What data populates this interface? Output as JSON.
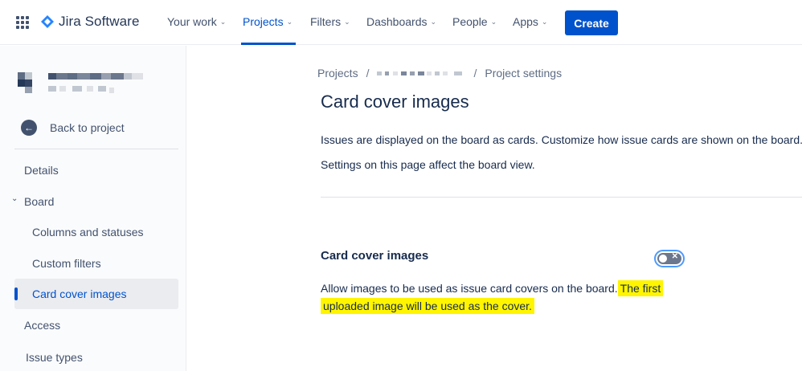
{
  "app": {
    "brand": "Jira Software",
    "brand_color": "#0052cc"
  },
  "topnav": {
    "items": [
      {
        "label": "Your work"
      },
      {
        "label": "Projects"
      },
      {
        "label": "Filters"
      },
      {
        "label": "Dashboards"
      },
      {
        "label": "People"
      },
      {
        "label": "Apps"
      }
    ],
    "active": "Projects",
    "create_label": "Create"
  },
  "sidebar": {
    "back_label": "Back to project",
    "items": [
      {
        "label": "Details"
      },
      {
        "label": "Board"
      },
      {
        "label": "Columns and statuses"
      },
      {
        "label": "Custom filters"
      },
      {
        "label": "Card cover images"
      },
      {
        "label": "Access"
      },
      {
        "label": "Issue types"
      }
    ],
    "selected": "Card cover images"
  },
  "main": {
    "breadcrumb": {
      "first": "Projects",
      "last": "Project settings"
    },
    "title": "Card cover images",
    "intro_1": "Issues are displayed on the board as cards. Customize how issue cards are shown on the board.",
    "intro_2": "Settings on this page affect the board view.",
    "section_title": "Card cover images",
    "toggle_state": "off",
    "desc_plain": "Allow images to be used as issue card covers on the board.",
    "desc_highlight_1": "The first",
    "desc_highlight_2": "uploaded image will be used as the cover.",
    "highlight_color": "#fff500"
  }
}
